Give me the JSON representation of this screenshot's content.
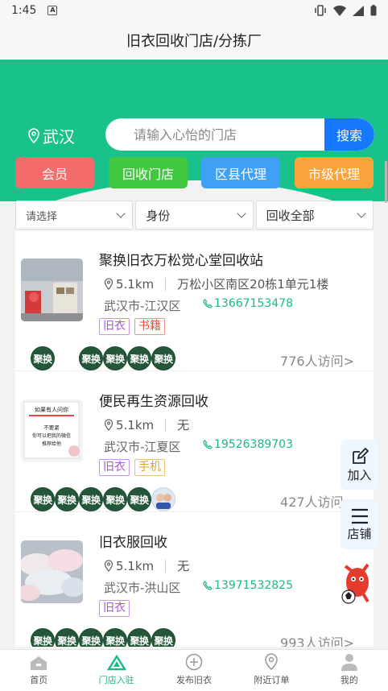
{
  "status_bar": {
    "time": "1:45",
    "app_icon": "A"
  },
  "header": {
    "title": "旧衣回收门店/分拣厂"
  },
  "location": {
    "city": "武汉"
  },
  "search": {
    "placeholder": "请输入心怡的门店",
    "button_label": "搜索"
  },
  "categories": [
    {
      "label": "会员",
      "color": "#f36b6b"
    },
    {
      "label": "回收门店",
      "color": "#42c741"
    },
    {
      "label": "区县代理",
      "color": "#3fa0f6"
    },
    {
      "label": "市级代理",
      "color": "#fba23a"
    }
  ],
  "filters": [
    {
      "label": "请选择"
    },
    {
      "label": "身份"
    },
    {
      "label": "回收全部"
    }
  ],
  "stores": [
    {
      "name": "聚换旧衣万松觉心堂回收站",
      "distance": "5.1km",
      "address": "万松小区南区20栋1单元1楼",
      "city": "武汉市-江汉区",
      "phone": "13667153478",
      "tags": [
        {
          "label": "旧衣",
          "style": "purple"
        },
        {
          "label": "书籍",
          "style": "red"
        }
      ],
      "avatar_text": "聚换",
      "visits": "776人访问>"
    },
    {
      "name": "便民再生资源回收",
      "distance": "5.1km",
      "address": "无",
      "city": "武汉市-江夏区",
      "phone": "19526389703",
      "tags": [
        {
          "label": "旧衣",
          "style": "purple"
        },
        {
          "label": "手机",
          "style": "orange"
        }
      ],
      "avatar_text": "聚换",
      "visits": "427人访问>",
      "sign_text": {
        "line1": "如果有人问你",
        "line2": "你可以把我的微信",
        "line3": "不要紧",
        "line4": "推荐给他"
      }
    },
    {
      "name": "旧衣服回收",
      "distance": "5.1km",
      "address": "无",
      "city": "武汉市-洪山区",
      "phone": "13971532825",
      "tags": [
        {
          "label": "旧衣",
          "style": "purple"
        }
      ],
      "avatar_text": "聚换",
      "visits": "993人访问>"
    }
  ],
  "floating": {
    "join_label": "加入",
    "shop_label": "店铺"
  },
  "tabbar": [
    {
      "label": "首页",
      "icon": "home-icon",
      "active": false
    },
    {
      "label": "门店入驻",
      "icon": "recycle-icon",
      "active": true
    },
    {
      "label": "发布旧衣",
      "icon": "plus-circle-icon",
      "active": false
    },
    {
      "label": "附近订单",
      "icon": "map-pin-icon",
      "active": false
    },
    {
      "label": "我的",
      "icon": "user-icon",
      "active": false
    }
  ]
}
